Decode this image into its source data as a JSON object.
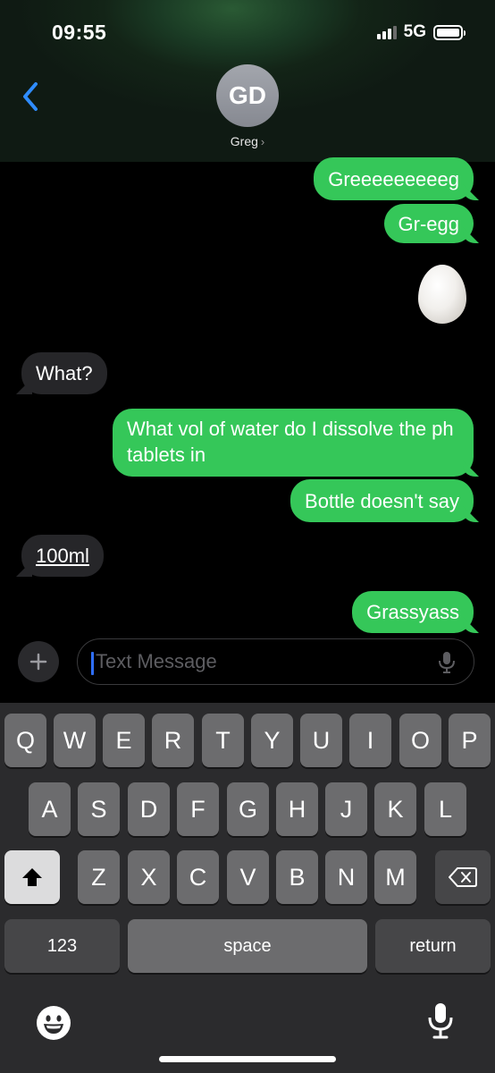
{
  "status_bar": {
    "time": "09:55",
    "network": "5G"
  },
  "header": {
    "avatar_initials": "GD",
    "contact_name": "Greg"
  },
  "messages": [
    {
      "text": "Greeeeeeeeeg",
      "direction": "outgoing"
    },
    {
      "text": "Gr-egg",
      "direction": "outgoing"
    },
    {
      "text": "What?",
      "direction": "incoming"
    },
    {
      "text": "What vol of water do I dissolve the ph tablets in",
      "direction": "outgoing"
    },
    {
      "text": "Bottle doesn't say",
      "direction": "outgoing"
    },
    {
      "text": "100ml",
      "direction": "incoming"
    },
    {
      "text": "Grassyass",
      "direction": "outgoing"
    }
  ],
  "input": {
    "placeholder": "Text Message"
  },
  "keyboard": {
    "row1": [
      "Q",
      "W",
      "E",
      "R",
      "T",
      "Y",
      "U",
      "I",
      "O",
      "P"
    ],
    "row2": [
      "A",
      "S",
      "D",
      "F",
      "G",
      "H",
      "J",
      "K",
      "L"
    ],
    "row3": [
      "Z",
      "X",
      "C",
      "V",
      "B",
      "N",
      "M"
    ],
    "numbers_label": "123",
    "space_label": "space",
    "return_label": "return"
  },
  "colors": {
    "outgoing_bubble": "#35c759",
    "incoming_bubble": "#262629",
    "accent_blue": "#2f8cff"
  },
  "icons": [
    "back-chevron-icon",
    "plus-icon",
    "microphone-icon",
    "shift-icon",
    "delete-icon",
    "emoji-icon",
    "dictation-icon"
  ]
}
